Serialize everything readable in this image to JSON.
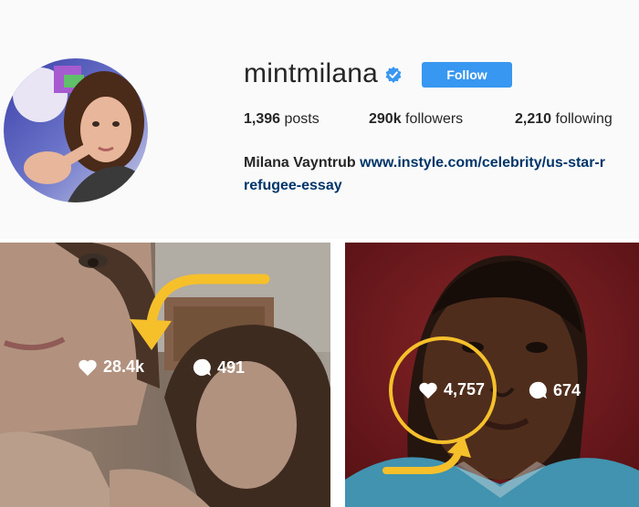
{
  "profile": {
    "username": "mintmilana",
    "follow_label": "Follow",
    "stats": {
      "posts_count": "1,396",
      "posts_label": "posts",
      "followers_count": "290k",
      "followers_label": "followers",
      "following_count": "2,210",
      "following_label": "following"
    },
    "bio": {
      "full_name": "Milana Vayntrub",
      "link_line1": "www.instyle.com/celebrity/us-star-r",
      "link_line2": "refugee-essay"
    }
  },
  "posts": [
    {
      "likes": "28.4k",
      "comments": "491"
    },
    {
      "likes": "4,757",
      "comments": "674"
    }
  ],
  "colors": {
    "accent": "#3897f0",
    "link": "#003569",
    "annotation": "#f6c02b",
    "header_bg": "#fafafa"
  },
  "icons": [
    "verified-badge-icon",
    "heart-icon",
    "comment-bubble-icon",
    "annotation-arrow",
    "annotation-circle"
  ]
}
